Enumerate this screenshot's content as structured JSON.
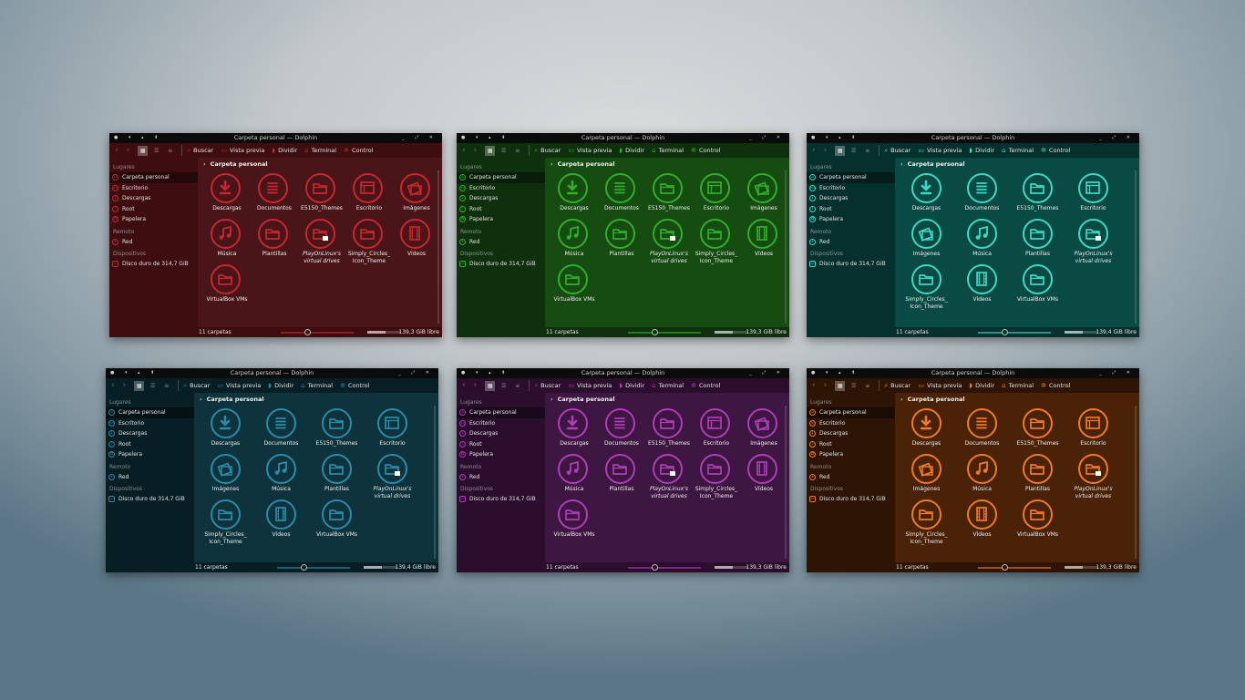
{
  "windows": [
    {
      "theme": "red",
      "title": "Carpeta personal — Dolphin",
      "bg": "#3d0d0f",
      "accent": "#c8272e",
      "mainbg": "#4a1518",
      "toolbar": [
        "Buscar",
        "Vista previa",
        "Dividir",
        "Terminal",
        "Control"
      ],
      "breadcrumb": "Carpeta personal",
      "sidebar": {
        "places_header": "Lugares",
        "places": [
          "Carpeta personal",
          "Escritorio",
          "Descargas",
          "Root",
          "Papelera"
        ],
        "remote_header": "Remoto",
        "remote": [
          "Red"
        ],
        "devices_header": "Dispositivos",
        "devices": [
          "Disco duro de 314,7 GiB"
        ]
      },
      "items": [
        {
          "label": "Descargas",
          "icon": "download",
          "italic": false
        },
        {
          "label": "Documentos",
          "icon": "documents",
          "italic": false
        },
        {
          "label": "E5150_Themes",
          "icon": "folder",
          "italic": false
        },
        {
          "label": "Escritorio",
          "icon": "desktop",
          "italic": false
        },
        {
          "label": "Imágenes",
          "icon": "images",
          "italic": false
        },
        {
          "label": "Música",
          "icon": "music",
          "italic": false
        },
        {
          "label": "Plantillas",
          "icon": "folder",
          "italic": false
        },
        {
          "label": "PlayOnLinux's virtual drives",
          "icon": "folder-link",
          "italic": true
        },
        {
          "label": "Simply_Circles_ Icon_Theme",
          "icon": "folder",
          "italic": false
        },
        {
          "label": "Vídeos",
          "icon": "video",
          "italic": false
        },
        {
          "label": "VirtualBox VMs",
          "icon": "folder",
          "italic": false
        }
      ],
      "status": {
        "count": "11 carpetas",
        "free": "139,3 GiB libre"
      }
    },
    {
      "theme": "green",
      "title": "Carpeta personal — Dolphin",
      "bg": "#0e300c",
      "accent": "#2fb029",
      "mainbg": "#164b12",
      "toolbar": [
        "Buscar",
        "Vista previa",
        "Dividir",
        "Terminal",
        "Control"
      ],
      "breadcrumb": "Carpeta personal",
      "sidebar": {
        "places_header": "Lugares",
        "places": [
          "Carpeta personal",
          "Escritorio",
          "Descargas",
          "Root",
          "Papelera"
        ],
        "remote_header": "Remoto",
        "remote": [
          "Red"
        ],
        "devices_header": "Dispositivos",
        "devices": [
          "Disco duro de 314,7 GiB"
        ]
      },
      "items": [
        {
          "label": "Descargas",
          "icon": "download",
          "italic": false
        },
        {
          "label": "Documentos",
          "icon": "documents",
          "italic": false
        },
        {
          "label": "E5150_Themes",
          "icon": "folder",
          "italic": false
        },
        {
          "label": "Escritorio",
          "icon": "desktop",
          "italic": false
        },
        {
          "label": "Imágenes",
          "icon": "images",
          "italic": false
        },
        {
          "label": "Música",
          "icon": "music",
          "italic": false
        },
        {
          "label": "Plantillas",
          "icon": "folder",
          "italic": false
        },
        {
          "label": "PlayOnLinux's virtual drives",
          "icon": "folder-link",
          "italic": true
        },
        {
          "label": "Simply_Circles_ Icon_Theme",
          "icon": "folder",
          "italic": false
        },
        {
          "label": "Vídeos",
          "icon": "video",
          "italic": false
        },
        {
          "label": "VirtualBox VMs",
          "icon": "folder",
          "italic": false
        }
      ],
      "status": {
        "count": "11 carpetas",
        "free": "139,3 GiB libre"
      }
    },
    {
      "theme": "teal",
      "title": "Carpeta personal — Dolphin",
      "bg": "#06302e",
      "accent": "#3dd9c4",
      "mainbg": "#0a4a44",
      "toolbar": [
        "Buscar",
        "Vista previa",
        "Dividir",
        "Terminal",
        "Control"
      ],
      "breadcrumb": "Carpeta personal",
      "sidebar": {
        "places_header": "Lugares",
        "places": [
          "Carpeta personal",
          "Escritorio",
          "Descargas",
          "Root",
          "Papelera"
        ],
        "remote_header": "Remoto",
        "remote": [
          "Red"
        ],
        "devices_header": "Dispositivos",
        "devices": [
          "Disco duro de 314,7 GiB"
        ]
      },
      "items": [
        {
          "label": "Descargas",
          "icon": "download",
          "italic": false
        },
        {
          "label": "Documentos",
          "icon": "documents",
          "italic": false
        },
        {
          "label": "E5150_Themes",
          "icon": "folder",
          "italic": false
        },
        {
          "label": "Escritorio",
          "icon": "desktop",
          "italic": false
        },
        {
          "label": "Imágenes",
          "icon": "images",
          "italic": false
        },
        {
          "label": "Música",
          "icon": "music",
          "italic": false
        },
        {
          "label": "Plantillas",
          "icon": "folder",
          "italic": false
        },
        {
          "label": "PlayOnLinux's virtual drives",
          "icon": "folder-link",
          "italic": true
        },
        {
          "label": "Simply_Circles_ Icon_Theme",
          "icon": "folder",
          "italic": false
        },
        {
          "label": "Vídeos",
          "icon": "video",
          "italic": false
        },
        {
          "label": "VirtualBox VMs",
          "icon": "folder",
          "italic": false
        }
      ],
      "status": {
        "count": "11 carpetas",
        "free": "139,4 GiB libre"
      }
    },
    {
      "theme": "blue",
      "title": "Carpeta personal — Dolphin",
      "bg": "#071e24",
      "accent": "#2a8ba8",
      "mainbg": "#0e333d",
      "toolbar": [
        "Buscar",
        "Vista previa",
        "Dividir",
        "Terminal",
        "Control"
      ],
      "breadcrumb": "Carpeta personal",
      "sidebar": {
        "places_header": "Lugares",
        "places": [
          "Carpeta personal",
          "Escritorio",
          "Descargas",
          "Root",
          "Papelera"
        ],
        "remote_header": "Remoto",
        "remote": [
          "Red"
        ],
        "devices_header": "Dispositivos",
        "devices": [
          "Disco duro de 314,7 GiB"
        ]
      },
      "items": [
        {
          "label": "Descargas",
          "icon": "download",
          "italic": false
        },
        {
          "label": "Documentos",
          "icon": "documents",
          "italic": false
        },
        {
          "label": "E5150_Themes",
          "icon": "folder",
          "italic": false
        },
        {
          "label": "Escritorio",
          "icon": "desktop",
          "italic": false
        },
        {
          "label": "Imágenes",
          "icon": "images",
          "italic": false
        },
        {
          "label": "Música",
          "icon": "music",
          "italic": false
        },
        {
          "label": "Plantillas",
          "icon": "folder",
          "italic": false
        },
        {
          "label": "PlayOnLinux's virtual drives",
          "icon": "folder-link",
          "italic": true
        },
        {
          "label": "Simply_Circles_ Icon_Theme",
          "icon": "folder",
          "italic": false
        },
        {
          "label": "Vídeos",
          "icon": "video",
          "italic": false
        },
        {
          "label": "VirtualBox VMs",
          "icon": "folder",
          "italic": false
        }
      ],
      "status": {
        "count": "11 carpetas",
        "free": "139,4 GiB libre"
      }
    },
    {
      "theme": "purple",
      "title": "Carpeta personal — Dolphin",
      "bg": "#2b0d2e",
      "accent": "#b03cb8",
      "mainbg": "#3e1642",
      "toolbar": [
        "Buscar",
        "Vista previa",
        "Dividir",
        "Terminal",
        "Control"
      ],
      "breadcrumb": "Carpeta personal",
      "sidebar": {
        "places_header": "Lugares",
        "places": [
          "Carpeta personal",
          "Escritorio",
          "Descargas",
          "Root",
          "Papelera"
        ],
        "remote_header": "Remoto",
        "remote": [
          "Red"
        ],
        "devices_header": "Dispositivos",
        "devices": [
          "Disco duro de 314,7 GiB"
        ]
      },
      "items": [
        {
          "label": "Descargas",
          "icon": "download",
          "italic": false
        },
        {
          "label": "Documentos",
          "icon": "documents",
          "italic": false
        },
        {
          "label": "E5150_Themes",
          "icon": "folder",
          "italic": false
        },
        {
          "label": "Escritorio",
          "icon": "desktop",
          "italic": false
        },
        {
          "label": "Imágenes",
          "icon": "images",
          "italic": false
        },
        {
          "label": "Música",
          "icon": "music",
          "italic": false
        },
        {
          "label": "Plantillas",
          "icon": "folder",
          "italic": false
        },
        {
          "label": "PlayOnLinux's virtual drives",
          "icon": "folder-link",
          "italic": true
        },
        {
          "label": "Simply_Circles_ Icon_Theme",
          "icon": "folder",
          "italic": false
        },
        {
          "label": "Vídeos",
          "icon": "video",
          "italic": false
        },
        {
          "label": "VirtualBox VMs",
          "icon": "folder",
          "italic": false
        }
      ],
      "status": {
        "count": "11 carpetas",
        "free": "139,3 GiB libre"
      }
    },
    {
      "theme": "orange",
      "title": "Carpeta personal — Dolphin",
      "bg": "#2d1405",
      "accent": "#f07a26",
      "mainbg": "#4a2208",
      "toolbar": [
        "Buscar",
        "Vista previa",
        "Dividir",
        "Terminal",
        "Control"
      ],
      "breadcrumb": "Carpeta personal",
      "sidebar": {
        "places_header": "Lugares",
        "places": [
          "Carpeta personal",
          "Escritorio",
          "Descargas",
          "Root",
          "Papelera"
        ],
        "remote_header": "Remoto",
        "remote": [
          "Red"
        ],
        "devices_header": "Dispositivos",
        "devices": [
          "Disco duro de 314,7 GiB"
        ]
      },
      "items": [
        {
          "label": "Descargas",
          "icon": "download",
          "italic": false
        },
        {
          "label": "Documentos",
          "icon": "documents",
          "italic": false
        },
        {
          "label": "E5150_Themes",
          "icon": "folder",
          "italic": false
        },
        {
          "label": "Escritorio",
          "icon": "desktop",
          "italic": false
        },
        {
          "label": "Imágenes",
          "icon": "images",
          "italic": false
        },
        {
          "label": "Música",
          "icon": "music",
          "italic": false
        },
        {
          "label": "Plantillas",
          "icon": "folder",
          "italic": false
        },
        {
          "label": "PlayOnLinux's virtual drives",
          "icon": "folder-link",
          "italic": true
        },
        {
          "label": "Simply_Circles_ Icon_Theme",
          "icon": "folder",
          "italic": false
        },
        {
          "label": "Vídeos",
          "icon": "video",
          "italic": false
        },
        {
          "label": "VirtualBox VMs",
          "icon": "folder",
          "italic": false
        }
      ],
      "status": {
        "count": "11 carpetas",
        "free": "139,3 GiB libre"
      }
    }
  ]
}
